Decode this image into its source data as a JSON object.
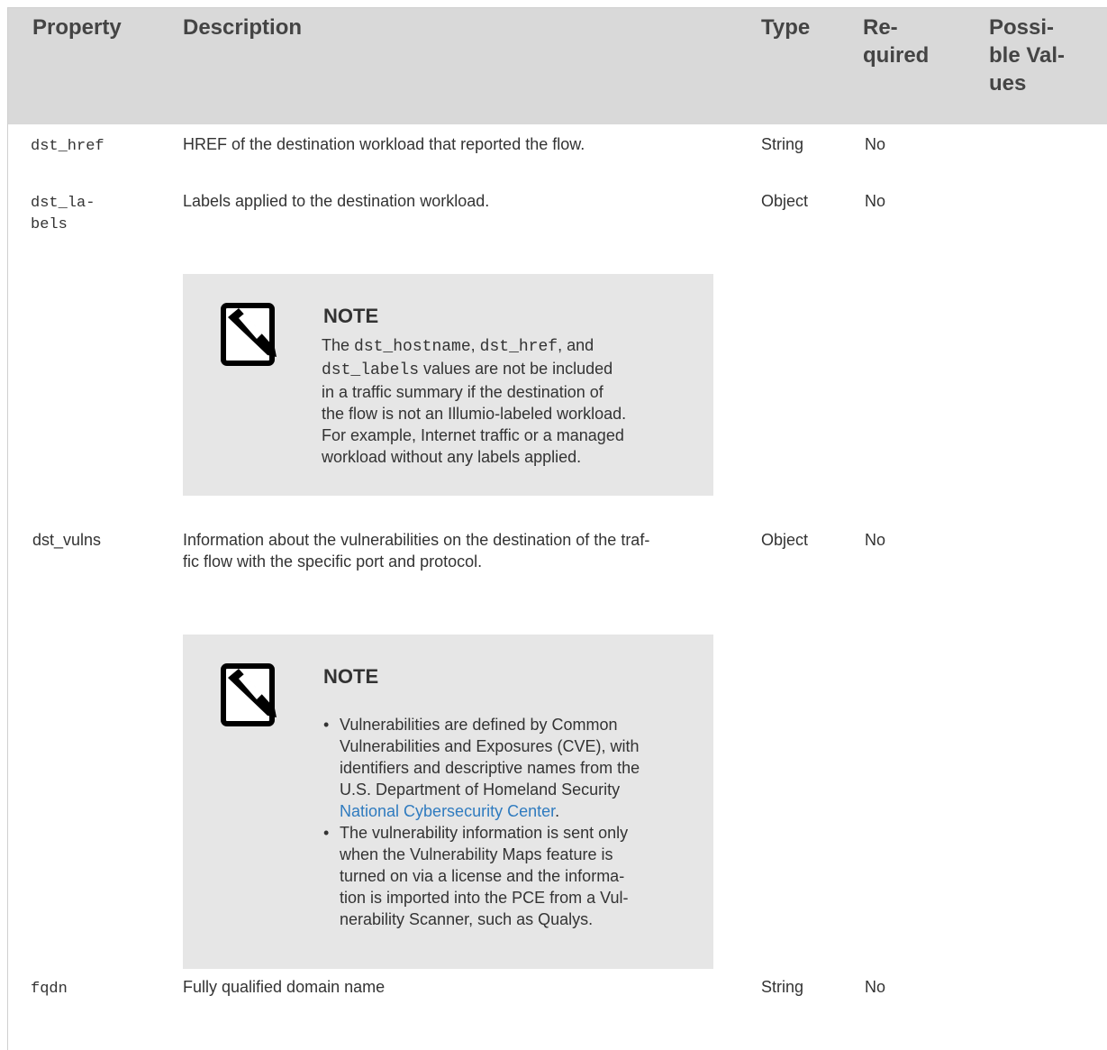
{
  "table": {
    "headers": {
      "property": "Property",
      "description": "Description",
      "type": "Type",
      "required": [
        "Re-",
        "quired"
      ],
      "values": [
        "Possi-",
        "ble Val-",
        "ues"
      ]
    },
    "rows": [
      {
        "property": "dst_href",
        "description": "HREF of the destination workload that reported the flow.",
        "type": "String",
        "required": "No"
      },
      {
        "property_lines": [
          "dst_la-",
          "bels"
        ],
        "description": "Labels applied to the destination workload.",
        "type": "Object",
        "required": "No",
        "note": {
          "title": "NOTE",
          "lines": [
            {
              "pre": "The ",
              "code1": "dst_hostname",
              "mid1": ", ",
              "code2": "dst_href",
              "post": ", and"
            },
            {
              "code": "dst_labels",
              "text": " values are not be included"
            },
            {
              "text": "in a traffic summary if the destination of"
            },
            {
              "text": "the flow is not an Illumio-labeled workload."
            },
            {
              "text": "For example, Internet traffic or a managed"
            },
            {
              "text": "workload without any labels applied."
            }
          ]
        }
      },
      {
        "property": "dst_vulns",
        "description_lines": [
          "Information about the vulnerabilities on the destination of the traf-",
          "fic flow with the specific port and protocol."
        ],
        "type": "Object",
        "required": "No",
        "note": {
          "title": "NOTE",
          "bullets": [
            {
              "lines": [
                "Vulnerabilities are defined by Common",
                "Vulnerabilities and Exposures (CVE), with",
                "identifiers and descriptive names from the",
                "U.S. Department of Homeland Security"
              ],
              "link": "National Cybersecurity Center",
              "after_link": "."
            },
            {
              "lines": [
                "The vulnerability information is sent only",
                "when the Vulnerability Maps feature is",
                "turned on via a license and the informa-",
                "tion is imported into the PCE from a Vul-",
                "nerability Scanner, such as Qualys."
              ]
            }
          ]
        }
      },
      {
        "property": "fqdn",
        "description": "Fully qualified domain name",
        "type": "String",
        "required": "No"
      }
    ]
  },
  "icons": {
    "note": "note-pencil-icon"
  },
  "colors": {
    "header_bg": "#d9d9d9",
    "note_bg": "#e6e6e6",
    "link": "#2f7bbf"
  }
}
